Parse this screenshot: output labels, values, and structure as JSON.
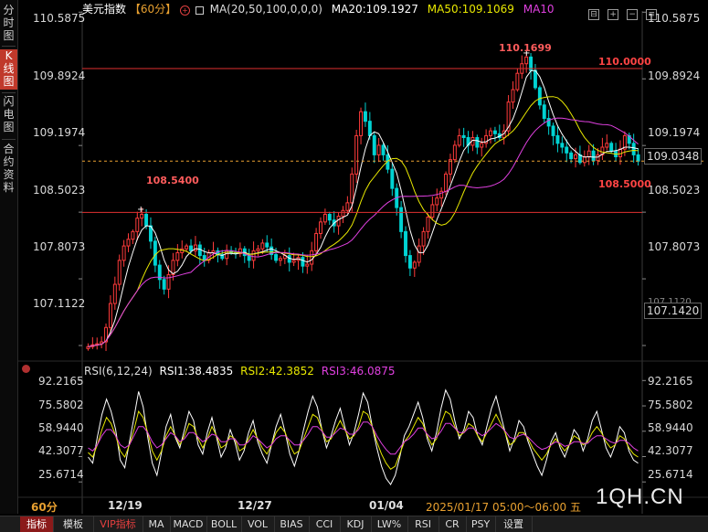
{
  "sidebar": {
    "tabs": [
      {
        "label": "分时图",
        "active": false
      },
      {
        "label": "K线图",
        "active": true
      },
      {
        "label": "闪电图",
        "active": false
      },
      {
        "label": "合约资料",
        "active": false
      }
    ]
  },
  "header": {
    "title": "美元指数",
    "period": "【60分】",
    "ma_params": "MA(20,50,100,0,0,0)",
    "ma20": "MA20:109.1927",
    "ma50": "MA50:109.1069",
    "ma10": "MA10"
  },
  "colors": {
    "up": "#ff3b3b",
    "down": "#00d3d3",
    "ma20": "#ffffff",
    "ma50": "#e8e800",
    "ma10": "#e040e0",
    "level": "#e03030",
    "rsi1": "#ffffff",
    "rsi2": "#e8e800",
    "rsi3": "#e040e0"
  },
  "price_axis": {
    "ticks": [
      "110.5875",
      "109.8924",
      "109.1974",
      "108.5023",
      "107.8073",
      "107.1122"
    ],
    "current_price": "109.0348",
    "low_tag": "107.1420",
    "partial_tick": "107.1120"
  },
  "levels": {
    "upper": "110.0000",
    "lower": "108.5000"
  },
  "annotations": {
    "high": "110.1699",
    "local_high": "108.5400"
  },
  "rsi": {
    "header": "RSI(6,12,24)",
    "rsi1": "RSI1:38.4835",
    "rsi2": "RSI2:42.3852",
    "rsi3": "RSI3:46.0875",
    "ticks": [
      "92.2165",
      "75.5802",
      "58.9440",
      "42.3077",
      "25.6714"
    ]
  },
  "x_axis": {
    "dates": [
      "12/19",
      "12/27",
      "01/04"
    ],
    "period_label": "60分",
    "cursor_time": "2025/01/17 05:00～06:00 五"
  },
  "watermark": "1QH.CN",
  "bottom_tabs": [
    "指标",
    "模板",
    "VIP指标",
    "MA",
    "MACD",
    "BOLL",
    "VOL",
    "BIAS",
    "CCI",
    "KDJ",
    "LW%",
    "RSI",
    "CR",
    "PSY",
    "设置"
  ],
  "chart_data": [
    {
      "type": "candlestick",
      "title": "美元指数",
      "period": "60分",
      "ylim": [
        106.9,
        110.6
      ],
      "levels": [
        110.0,
        108.5
      ],
      "annotations": [
        {
          "label": "110.1699",
          "y": 110.1699
        },
        {
          "label": "108.5400",
          "y": 108.54
        }
      ],
      "series": [
        {
          "name": "MA20",
          "last": 109.1927
        },
        {
          "name": "MA50",
          "last": 109.1069
        },
        {
          "name": "MA10"
        }
      ],
      "close": [
        107.1,
        107.12,
        107.13,
        107.15,
        107.3,
        107.55,
        107.75,
        108.0,
        108.15,
        108.22,
        108.3,
        108.44,
        108.48,
        108.36,
        108.2,
        107.95,
        107.8,
        107.7,
        107.85,
        108.0,
        108.08,
        108.12,
        108.15,
        108.1,
        108.16,
        108.05,
        108.0,
        108.08,
        108.1,
        108.06,
        108.02,
        108.1,
        108.08,
        108.07,
        108.12,
        108.05,
        108.0,
        108.1,
        108.12,
        108.18,
        108.14,
        108.06,
        108.0,
        108.02,
        108.05,
        107.98,
        108.0,
        108.03,
        107.94,
        107.96,
        108.1,
        108.28,
        108.4,
        108.48,
        108.42,
        108.36,
        108.46,
        108.52,
        108.6,
        108.9,
        109.3,
        109.55,
        109.45,
        109.3,
        109.1,
        109.2,
        109.1,
        108.95,
        108.75,
        108.55,
        108.3,
        108.05,
        107.92,
        107.98,
        108.15,
        108.3,
        108.45,
        108.58,
        108.65,
        108.72,
        108.9,
        109.05,
        109.2,
        109.3,
        109.28,
        109.2,
        109.28,
        109.18,
        109.22,
        109.3,
        109.35,
        109.32,
        109.28,
        109.35,
        109.65,
        109.78,
        109.95,
        110.05,
        110.12,
        109.98,
        109.8,
        109.62,
        109.48,
        109.4,
        109.3,
        109.22,
        109.18,
        109.12,
        109.06,
        109.1,
        109.02,
        109.08,
        109.14,
        109.04,
        109.1,
        109.18,
        109.22,
        109.14,
        109.08,
        109.16,
        109.3,
        109.22,
        109.1,
        109.0348
      ],
      "x_ticks": [
        "12/19",
        "12/27",
        "01/04"
      ]
    },
    {
      "type": "line",
      "title": "RSI(6,12,24)",
      "ylim": [
        18,
        95
      ],
      "yticks": [
        92.2165,
        75.5802,
        58.944,
        42.3077,
        25.6714
      ],
      "series": [
        {
          "name": "RSI1",
          "last": 38.4835,
          "values": [
            42,
            38,
            55,
            70,
            80,
            72,
            60,
            40,
            35,
            52,
            68,
            85,
            75,
            55,
            38,
            30,
            45,
            62,
            70,
            55,
            48,
            60,
            72,
            66,
            50,
            44,
            58,
            68,
            55,
            42,
            48,
            60,
            52,
            40,
            46,
            58,
            66,
            52,
            44,
            38,
            50,
            62,
            70,
            58,
            44,
            36,
            46,
            60,
            72,
            82,
            75,
            60,
            48,
            56,
            66,
            74,
            62,
            50,
            58,
            70,
            84,
            78,
            62,
            48,
            36,
            28,
            24,
            30,
            42,
            56,
            62,
            70,
            78,
            68,
            54,
            46,
            58,
            74,
            86,
            80,
            66,
            54,
            60,
            72,
            68,
            56,
            50,
            62,
            74,
            82,
            70,
            58,
            46,
            54,
            66,
            62,
            52,
            44,
            36,
            30,
            40,
            52,
            58,
            48,
            42,
            50,
            60,
            56,
            46,
            54,
            66,
            72,
            60,
            48,
            42,
            50,
            62,
            58,
            46,
            40,
            38
          ]
        },
        {
          "name": "RSI2",
          "last": 42.3852,
          "values": [
            45,
            42,
            50,
            60,
            68,
            64,
            56,
            46,
            42,
            50,
            60,
            72,
            68,
            58,
            46,
            40,
            46,
            56,
            62,
            56,
            50,
            56,
            64,
            62,
            54,
            48,
            54,
            62,
            56,
            48,
            50,
            56,
            54,
            46,
            48,
            54,
            60,
            54,
            48,
            44,
            50,
            58,
            62,
            58,
            50,
            44,
            46,
            54,
            62,
            70,
            68,
            60,
            52,
            54,
            60,
            66,
            60,
            54,
            56,
            62,
            72,
            70,
            62,
            52,
            44,
            38,
            34,
            36,
            44,
            52,
            56,
            62,
            68,
            64,
            56,
            50,
            54,
            64,
            72,
            70,
            62,
            56,
            58,
            64,
            62,
            56,
            52,
            58,
            64,
            70,
            64,
            58,
            50,
            52,
            58,
            58,
            54,
            48,
            44,
            40,
            44,
            50,
            54,
            50,
            46,
            50,
            56,
            54,
            50,
            52,
            58,
            62,
            58,
            52,
            48,
            50,
            56,
            54,
            48,
            44,
            42
          ]
        },
        {
          "name": "RSI3",
          "last": 46.0875,
          "values": [
            48,
            46,
            50,
            56,
            60,
            60,
            56,
            50,
            48,
            50,
            56,
            62,
            62,
            58,
            52,
            48,
            50,
            54,
            58,
            56,
            52,
            54,
            58,
            58,
            55,
            52,
            54,
            57,
            56,
            52,
            52,
            54,
            54,
            50,
            50,
            52,
            56,
            54,
            51,
            48,
            50,
            54,
            56,
            56,
            53,
            50,
            50,
            53,
            57,
            62,
            62,
            59,
            55,
            55,
            58,
            61,
            60,
            57,
            57,
            60,
            65,
            65,
            62,
            56,
            51,
            47,
            44,
            44,
            48,
            52,
            54,
            57,
            61,
            61,
            57,
            54,
            55,
            59,
            64,
            64,
            61,
            58,
            58,
            61,
            61,
            58,
            56,
            58,
            61,
            64,
            62,
            59,
            55,
            54,
            56,
            57,
            55,
            52,
            49,
            47,
            48,
            50,
            52,
            51,
            49,
            50,
            52,
            52,
            51,
            51,
            54,
            56,
            56,
            54,
            52,
            51,
            53,
            53,
            51,
            48,
            46
          ]
        }
      ],
      "x_ticks": [
        "12/19",
        "12/27",
        "01/04"
      ]
    }
  ]
}
